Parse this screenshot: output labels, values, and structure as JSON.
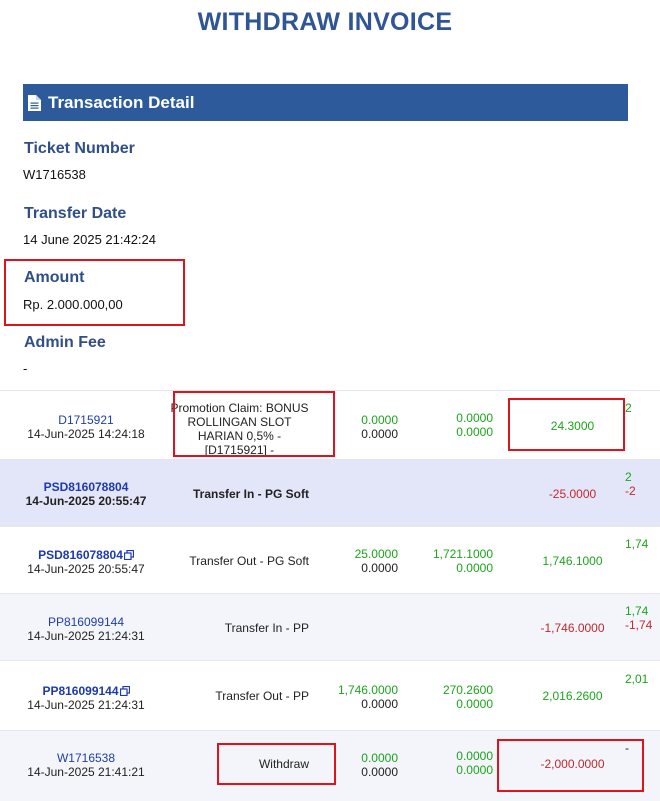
{
  "page_title": "WITHDRAW INVOICE",
  "section": {
    "title": "Transaction Detail",
    "icon": "document-icon"
  },
  "fields": {
    "ticket_label": "Ticket Number",
    "ticket_value": "W1716538",
    "date_label": "Transfer Date",
    "date_value": "14 June 2025 21:42:24",
    "amount_label": "Amount",
    "amount_value": "Rp. 2.000.000,00",
    "fee_label": "Admin Fee",
    "fee_value": "-"
  },
  "colors": {
    "title": "#2f5597",
    "section_bar": "#2c5a9a",
    "positive": "#1aa51a",
    "negative": "#c3292b",
    "highlight_box": "#e0121b"
  },
  "transactions": [
    {
      "ref": "D1715921",
      "datetime": "14-Jun-2025 14:24:18",
      "description": "Promotion Claim: BONUS ROLLINGAN SLOT HARIAN 0,5% - [D1715921] -",
      "before_a": "0.0000",
      "before_b": "0.0000",
      "after_a": "0.0000",
      "after_b": "0.0000",
      "amount": "24.3000",
      "edge": "2"
    },
    {
      "ref": "PSD816078804",
      "datetime": "14-Jun-2025 20:55:47",
      "description": "Transfer In - PG Soft",
      "amount": "-25.0000",
      "edge_a": "2",
      "edge_b": "-2"
    },
    {
      "ref": "PSD816078804",
      "datetime": "14-Jun-2025 20:55:47",
      "description": "Transfer Out - PG Soft",
      "before_a": "25.0000",
      "before_b": "0.0000",
      "after_a": "1,721.1000",
      "after_b": "0.0000",
      "amount": "1,746.1000",
      "edge": "1,74"
    },
    {
      "ref": "PP816099144",
      "datetime": "14-Jun-2025 21:24:31",
      "description": "Transfer In - PP",
      "amount": "-1,746.0000",
      "edge_a": "1,74",
      "edge_b": "-1,74"
    },
    {
      "ref": "PP816099144",
      "datetime": "14-Jun-2025 21:24:31",
      "description": "Transfer Out - PP",
      "before_a": "1,746.0000",
      "before_b": "0.0000",
      "after_a": "270.2600",
      "after_b": "0.0000",
      "amount": "2,016.2600",
      "edge": "2,01"
    },
    {
      "ref": "W1716538",
      "datetime": "14-Jun-2025 21:41:21",
      "description": "Withdraw",
      "before_a": "0.0000",
      "before_b": "0.0000",
      "after_a": "0.0000",
      "after_b": "0.0000",
      "amount": "-2,000.0000",
      "edge": "-"
    }
  ]
}
